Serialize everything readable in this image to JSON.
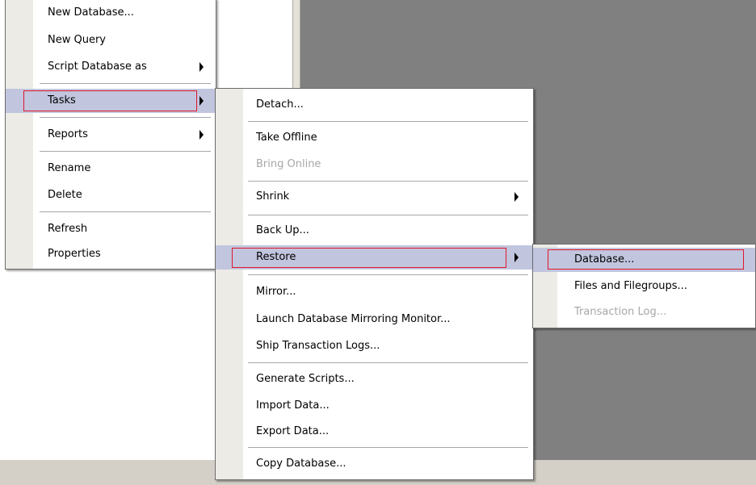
{
  "menu1": {
    "items": [
      "New Database...",
      "New Query",
      "Script Database as",
      "Tasks",
      "Reports",
      "Rename",
      "Delete",
      "Refresh",
      "Properties"
    ]
  },
  "menu2": {
    "items": [
      "Detach...",
      "Take Offline",
      "Bring Online",
      "Shrink",
      "Back Up...",
      "Restore",
      "Mirror...",
      "Launch Database Mirroring Monitor...",
      "Ship Transaction Logs...",
      "Generate Scripts...",
      "Import Data...",
      "Export Data...",
      "Copy Database..."
    ]
  },
  "menu3": {
    "items": [
      "Database...",
      "Files and Filegroups...",
      "Transaction Log..."
    ]
  },
  "colors": {
    "selected_bg": "#c1c5de",
    "highlight_box": "#e2162a",
    "disabled_text": "#a7a6aa",
    "workspace_gray": "#808080"
  }
}
